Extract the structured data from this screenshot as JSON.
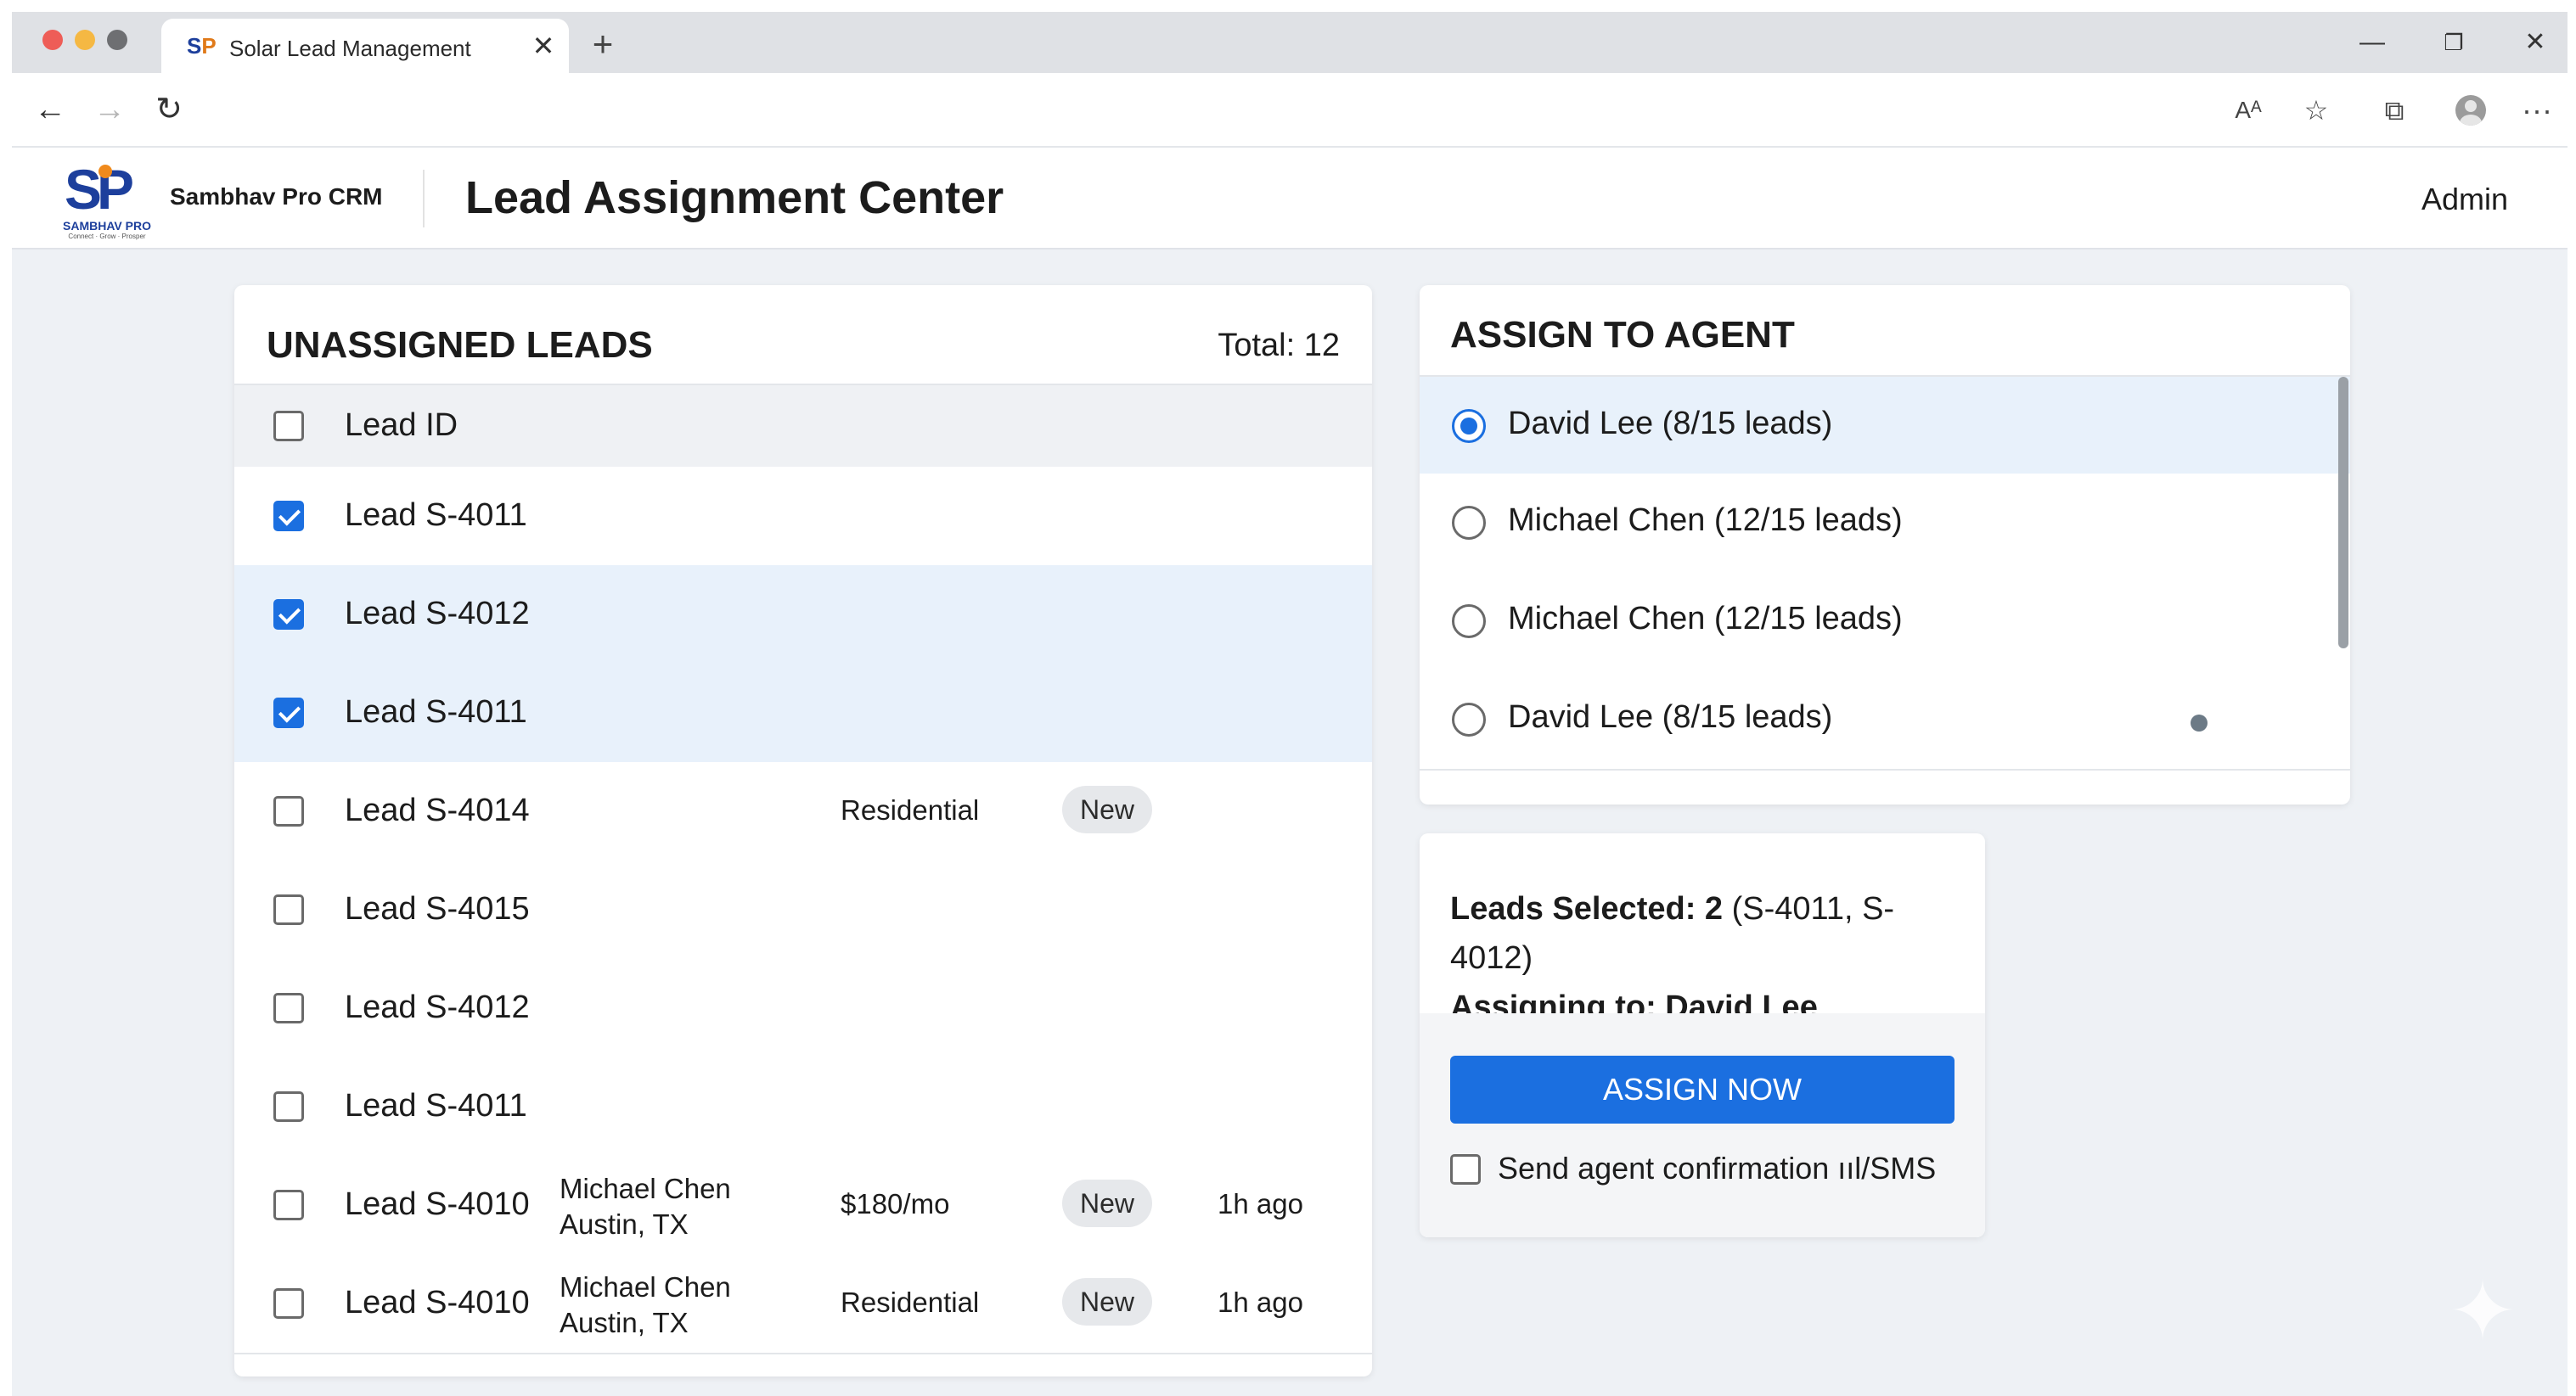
{
  "browser": {
    "tab_title": "Solar Lead Management",
    "tab_close_glyph": "✕",
    "new_tab_glyph": "+",
    "icons": {
      "back": "←",
      "forward": "→",
      "reload": "↻",
      "read_aloud": "Aᴬ",
      "favorite": "☆",
      "collections": "⧉",
      "more": "···",
      "minimize": "—",
      "maximize": "❐",
      "close": "✕"
    }
  },
  "header": {
    "logo_mark": "SP",
    "logo_name": "SAMBHAV PRO",
    "logo_tagline": "Connect · Grow · Prosper",
    "brand": "Sambhav Pro CRM",
    "title": "Lead Assignment Center",
    "user": "Admin"
  },
  "leads": {
    "title": "UNASSIGNED LEADS",
    "total": "Total: 12",
    "column_header": "Lead ID",
    "rows": [
      {
        "id": "Lead S-4011",
        "contact_name": "",
        "contact_city": "",
        "type": "",
        "status": "",
        "time": "",
        "checked": true,
        "highlight": false
      },
      {
        "id": "Lead S-4012",
        "contact_name": "",
        "contact_city": "",
        "type": "",
        "status": "",
        "time": "",
        "checked": true,
        "highlight": true
      },
      {
        "id": "Lead S-4011",
        "contact_name": "",
        "contact_city": "",
        "type": "",
        "status": "",
        "time": "",
        "checked": true,
        "highlight": true
      },
      {
        "id": "Lead S-4014",
        "contact_name": "",
        "contact_city": "",
        "type": "Residential",
        "status": "New",
        "time": "",
        "checked": false,
        "highlight": false
      },
      {
        "id": "Lead S-4015",
        "contact_name": "",
        "contact_city": "",
        "type": "",
        "status": "",
        "time": "",
        "checked": false,
        "highlight": false
      },
      {
        "id": "Lead S-4012",
        "contact_name": "",
        "contact_city": "",
        "type": "",
        "status": "",
        "time": "",
        "checked": false,
        "highlight": false
      },
      {
        "id": "Lead S-4011",
        "contact_name": "",
        "contact_city": "",
        "type": "",
        "status": "",
        "time": "",
        "checked": false,
        "highlight": false
      },
      {
        "id": "Lead S-4010",
        "contact_name": "Michael Chen",
        "contact_city": "Austin, TX",
        "type": "$180/mo",
        "status": "New",
        "time": "1h ago",
        "checked": false,
        "highlight": false
      },
      {
        "id": "Lead S-4010",
        "contact_name": "Michael Chen",
        "contact_city": "Austin, TX",
        "type": "Residential",
        "status": "New",
        "time": "1h ago",
        "checked": false,
        "highlight": false
      }
    ]
  },
  "agents": {
    "title": "ASSIGN TO AGENT",
    "options": [
      {
        "label": "David Lee (8/15 leads)",
        "selected": true
      },
      {
        "label": "Michael Chen (12/15 leads)",
        "selected": false
      },
      {
        "label": "Michael Chen (12/15 leads)",
        "selected": false
      },
      {
        "label": "David Lee (8/15 leads)",
        "selected": false
      }
    ]
  },
  "summary": {
    "selected_label": "Leads Selected: 2",
    "selected_ids": " (S-4011, S-4012)",
    "assigning_label": "Assigning to: David Lee",
    "assign_button": "ASSIGN NOW",
    "confirm_label": "Send agent confirmation ııl/SMS",
    "confirm_checked": false
  },
  "colors": {
    "accent": "#1b6fe0",
    "selected_row": "#e8f1fb",
    "page_background": "#eef1f5"
  }
}
